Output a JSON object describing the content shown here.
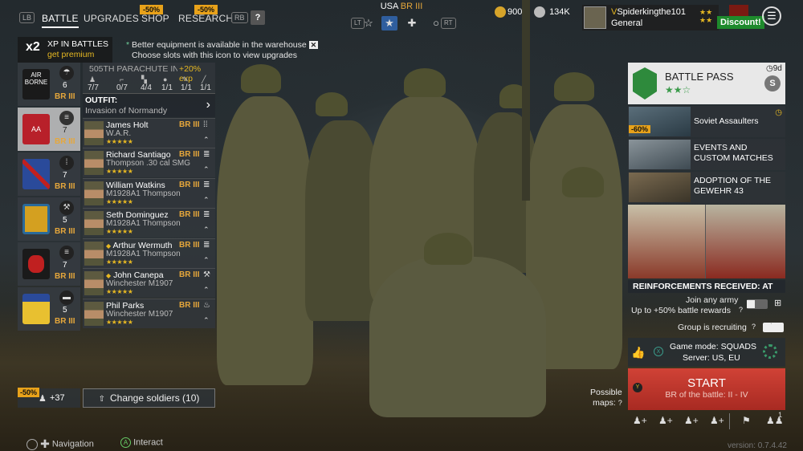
{
  "topbar": {
    "lb": "LB",
    "rb": "RB",
    "tabs": [
      {
        "label": "BATTLE"
      },
      {
        "label": "UPGRADES"
      },
      {
        "label": "SHOP",
        "sale": "-50%"
      },
      {
        "label": "RESEARCH",
        "sale": "-50%"
      }
    ],
    "help": "?",
    "army": {
      "name": "USA",
      "br": "BR III",
      "lt": "LT",
      "rt": "RT"
    },
    "gold": "900",
    "silver": "134K",
    "profile": {
      "name": "Spiderkingthe101",
      "rank": "General"
    },
    "discount": "Discount!"
  },
  "xp": {
    "mult": "x2",
    "title": "XP IN BATTLES",
    "sub": "get premium"
  },
  "notice": {
    "line1": "Better equipment is available in the warehouse",
    "line2": "Choose slots with this icon to view upgrades"
  },
  "squads": [
    {
      "count": "6",
      "br": "BR III",
      "color": "#1a1a1a",
      "accent": "#ffffff"
    },
    {
      "count": "7",
      "br": "BR III",
      "color": "#b8202a",
      "accent": "#ffffff"
    },
    {
      "count": "7",
      "br": "BR III",
      "color": "#2a4a9a",
      "accent": "#c02020"
    },
    {
      "count": "5",
      "br": "BR III",
      "color": "#d4a020",
      "accent": "#2a6a9a"
    },
    {
      "count": "7",
      "br": "BR III",
      "color": "#1a1a1a",
      "accent": "#c02020"
    },
    {
      "count": "5",
      "br": "BR III",
      "color": "#e8c030",
      "accent": "#2a4a9a"
    }
  ],
  "roster": {
    "squad_name": "505TH PARACHUTE IN",
    "bonus": "+20% exp",
    "stats": [
      "7/7",
      "0/7",
      "4/4",
      "1/1",
      "1/1",
      "1/1"
    ],
    "outfit_label": "OUTFIT:",
    "outfit_name": "Invasion of Normandy",
    "soldiers": [
      {
        "name": "James Holt",
        "weapon": "W.A.R.",
        "br": "BR III",
        "stars": "★★★★★",
        "rank": "III"
      },
      {
        "name": "Richard Santiago",
        "weapon": "Thompson .30 cal SMG",
        "br": "BR III",
        "stars": "★★★★★",
        "rank": "III"
      },
      {
        "name": "William Watkins",
        "weapon": "M1928A1 Thompson",
        "br": "BR III",
        "stars": "★★★★★",
        "rank": "III"
      },
      {
        "name": "Seth Dominguez",
        "weapon": "M1928A1 Thompson",
        "br": "BR III",
        "stars": "★★★★★",
        "rank": "III"
      },
      {
        "name": "Arthur Wermuth",
        "weapon": "M1928A1 Thompson",
        "br": "BR III",
        "stars": "★★★★★",
        "rank": "III"
      },
      {
        "name": "John Canepa",
        "weapon": "Winchester M1907",
        "br": "BR III",
        "stars": "★★★★★",
        "rank": "III"
      },
      {
        "name": "Phil Parks",
        "weapon": "Winchester M1907",
        "br": "BR III",
        "stars": "★★★★★",
        "rank": "III"
      }
    ]
  },
  "bottom": {
    "sale": "-50%",
    "plus": "+37",
    "change": "Change soldiers (10)"
  },
  "hints": {
    "nav": "Navigation",
    "interact": "Interact"
  },
  "battlepass": {
    "title": "BATTLE PASS",
    "stars": "★★☆",
    "days": "9d"
  },
  "events": [
    {
      "title": "Soviet Assaulters",
      "sale": "-60%"
    },
    {
      "title": "EVENTS AND CUSTOM MATCHES"
    },
    {
      "title": "ADOPTION OF THE GEWEHR 43"
    }
  ],
  "reinforcements": "REINFORCEMENTS RECEIVED: AT",
  "join": {
    "line1": "Join any army",
    "line2": "Up to +50% battle rewards"
  },
  "group": "Group is recruiting",
  "gamemode": {
    "line1": "Game mode: SQUADS",
    "line2": "Server: US, EU"
  },
  "start": {
    "title": "START",
    "sub": "BR of the battle: II - IV"
  },
  "possible": {
    "line1": "Possible",
    "line2": "maps:"
  },
  "footer_count": "1",
  "version": "version: 0.7.4.42"
}
